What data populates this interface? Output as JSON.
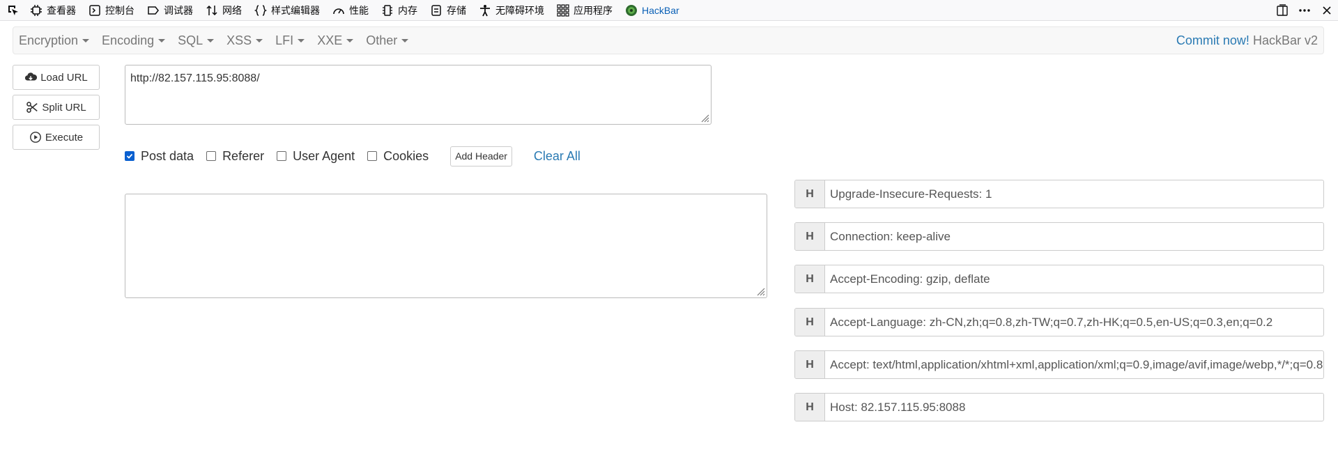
{
  "devtools": {
    "tabs": [
      {
        "icon": "inspector-icon",
        "label": "查看器"
      },
      {
        "icon": "console-icon",
        "label": "控制台"
      },
      {
        "icon": "debugger-icon",
        "label": "调试器"
      },
      {
        "icon": "network-icon",
        "label": "网络"
      },
      {
        "icon": "style-editor-icon",
        "label": "样式编辑器"
      },
      {
        "icon": "performance-icon",
        "label": "性能"
      },
      {
        "icon": "memory-icon",
        "label": "内存"
      },
      {
        "icon": "storage-icon",
        "label": "存储"
      },
      {
        "icon": "accessibility-icon",
        "label": "无障碍环境"
      },
      {
        "icon": "application-icon",
        "label": "应用程序"
      },
      {
        "icon": "hackbar-icon",
        "label": "HackBar"
      }
    ],
    "active_tab": "HackBar",
    "accent": "#0a60b6"
  },
  "menu": {
    "items": [
      "Encryption",
      "Encoding",
      "SQL",
      "XSS",
      "LFI",
      "XXE",
      "Other"
    ],
    "commit_label": "Commit now!",
    "brand_label": "HackBar v2"
  },
  "buttons": {
    "load_url": "Load URL",
    "split_url": "Split URL",
    "execute": "Execute"
  },
  "url": {
    "value": "http://82.157.115.95:8088/"
  },
  "options": {
    "post_data": {
      "label": "Post data",
      "checked": true
    },
    "referer": {
      "label": "Referer",
      "checked": false
    },
    "user_agent": {
      "label": "User Agent",
      "checked": false
    },
    "cookies": {
      "label": "Cookies",
      "checked": false
    },
    "add_header": "Add Header",
    "clear_all": "Clear All"
  },
  "post_body": {
    "value": ""
  },
  "headers": [
    {
      "badge": "H",
      "value": "Upgrade-Insecure-Requests: 1"
    },
    {
      "badge": "H",
      "value": "Connection: keep-alive"
    },
    {
      "badge": "H",
      "value": "Accept-Encoding: gzip, deflate"
    },
    {
      "badge": "H",
      "value": "Accept-Language: zh-CN,zh;q=0.8,zh-TW;q=0.7,zh-HK;q=0.5,en-US;q=0.3,en;q=0.2"
    },
    {
      "badge": "H",
      "value": "Accept: text/html,application/xhtml+xml,application/xml;q=0.9,image/avif,image/webp,*/*;q=0.8"
    },
    {
      "badge": "H",
      "value": "Host: 82.157.115.95:8088"
    }
  ]
}
